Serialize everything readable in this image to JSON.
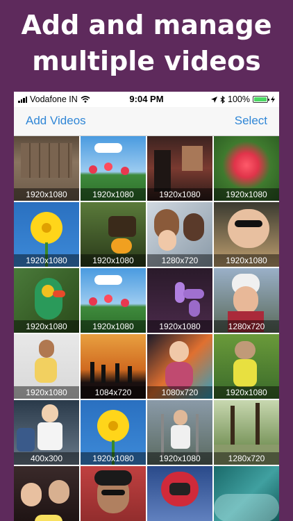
{
  "headline": {
    "line1": "Add and manage",
    "line2": "multiple videos"
  },
  "status_bar": {
    "carrier": "Vodafone IN",
    "time": "9:04 PM",
    "battery": "100%",
    "battery_level": 1.0
  },
  "nav": {
    "left": "Add Videos",
    "right": "Select"
  },
  "colors": {
    "background": "#5e2a5c",
    "accent": "#2f86d6",
    "battery": "#4cd964"
  },
  "videos": [
    {
      "resolution": "1920x1080"
    },
    {
      "resolution": "1920x1080"
    },
    {
      "resolution": "1920x1080"
    },
    {
      "resolution": "1920x1080"
    },
    {
      "resolution": "1920x1080"
    },
    {
      "resolution": "1920x1080"
    },
    {
      "resolution": "1280x720"
    },
    {
      "resolution": "1920x1080"
    },
    {
      "resolution": "1920x1080"
    },
    {
      "resolution": "1920x1080"
    },
    {
      "resolution": "1920x1080"
    },
    {
      "resolution": "1280x720"
    },
    {
      "resolution": "1920x1080"
    },
    {
      "resolution": "1084x720"
    },
    {
      "resolution": "1080x720"
    },
    {
      "resolution": "1920x1080"
    },
    {
      "resolution": "400x300"
    },
    {
      "resolution": "1920x1080"
    },
    {
      "resolution": "1920x1080"
    },
    {
      "resolution": "1280x720"
    },
    {
      "resolution": ""
    },
    {
      "resolution": ""
    },
    {
      "resolution": ""
    },
    {
      "resolution": ""
    }
  ]
}
